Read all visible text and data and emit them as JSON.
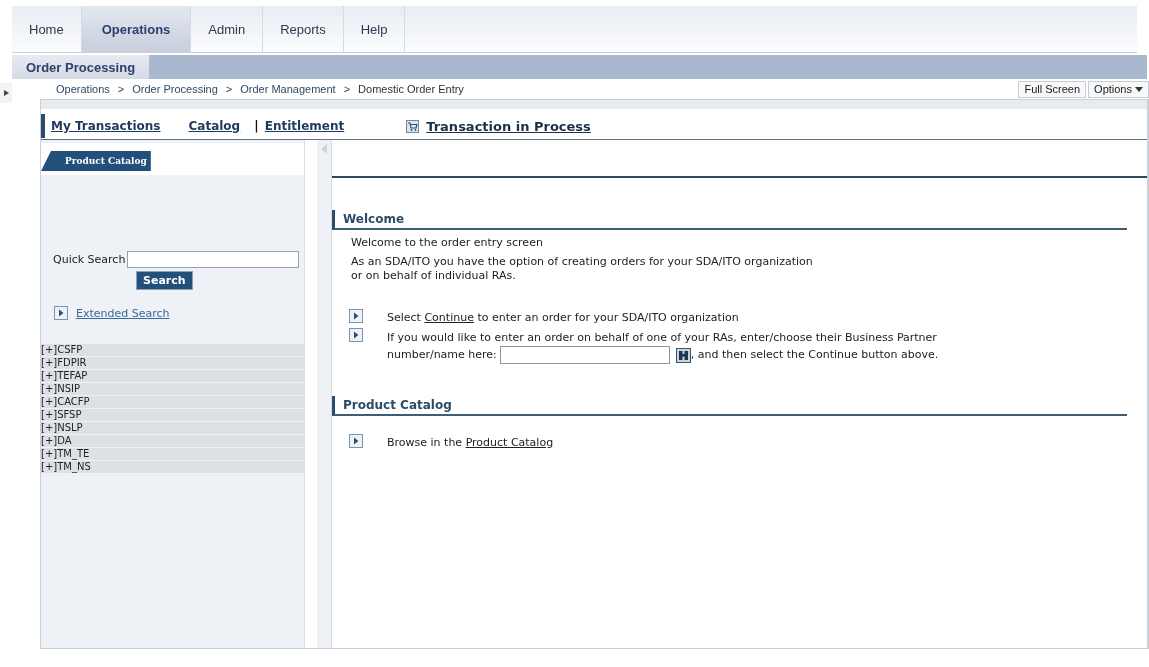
{
  "top_tabs": [
    {
      "label": "Home",
      "selected": false
    },
    {
      "label": "Operations",
      "selected": true
    },
    {
      "label": "Admin",
      "selected": false
    },
    {
      "label": "Reports",
      "selected": false
    },
    {
      "label": "Help",
      "selected": false
    }
  ],
  "sub_tabs": [
    {
      "label": "Order Processing",
      "selected": true
    }
  ],
  "breadcrumb": [
    "Operations",
    "Order Processing",
    "Order Management",
    "Domestic Order Entry"
  ],
  "breadcrumb_separator": ">",
  "header_buttons": [
    {
      "label": "Full Screen",
      "kind": "plain"
    },
    {
      "label": "Options",
      "kind": "menu"
    }
  ],
  "nav_links": [
    {
      "label": "My Transactions",
      "kind": "link"
    },
    {
      "label": "Catalog",
      "kind": "link"
    },
    {
      "label": "| ",
      "kind": "divider"
    },
    {
      "label": "Entitlement",
      "kind": "link"
    },
    {
      "label": "Transaction in Process",
      "kind": "cart"
    }
  ],
  "sidebar": {
    "tab": "Product Catalog",
    "quick_search_label": "Quick Search",
    "search_button": "Search",
    "extended_search": "Extended Search",
    "tree": [
      {
        "label": "[+]CSFP",
        "expanded": false
      },
      {
        "label": "[+]FDPIR",
        "expanded": false
      },
      {
        "label": "[+]TEFAP",
        "expanded": false
      },
      {
        "label": "[+]NSIP",
        "expanded": false
      },
      {
        "label": "[+]CACFP",
        "expanded": false
      },
      {
        "label": "[+]SFSP",
        "expanded": false
      },
      {
        "label": "[+]NSLP",
        "expanded": false
      },
      {
        "label": "[+]DA",
        "expanded": false
      },
      {
        "label": "[+]TM_TE",
        "expanded": false
      },
      {
        "label": "[+]TM_NS",
        "expanded": false
      }
    ]
  },
  "welcome": {
    "title": "Welcome",
    "intro": "Welcome to the order entry screen",
    "description": "As an SDA/ITO you have the option of creating orders for your SDA/ITO organization or on behalf of individual RAs.",
    "select_line": {
      "before": "Select ",
      "link": "Continue",
      "after": " to enter an order for your SDA/ITO organization"
    },
    "partner_line": {
      "first": "If you would like to enter an order on behalf of one of your RAs, enter/choose their Business Partner",
      "before": "number/name here:",
      "after": ", and then select the Continue button above."
    }
  },
  "catalog_section": {
    "title": "Product Catalog",
    "before": "Browse in the ",
    "link": "Product Catalog"
  }
}
